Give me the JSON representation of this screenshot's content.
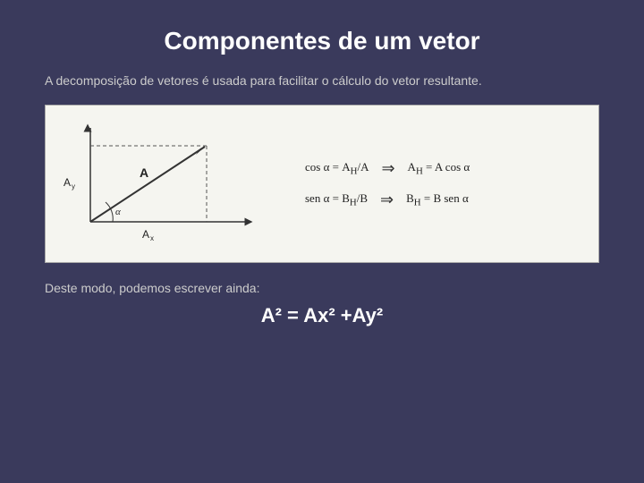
{
  "slide": {
    "title": "Componentes de um vetor",
    "description": "A decomposição de vetores é usada para facilitar o cálculo do vetor resultante.",
    "formula1_left": "cos α = A",
    "formula1_sub_left": "H",
    "formula1_mid": "/A",
    "formula1_arrow": "⇒",
    "formula1_right": "A",
    "formula1_sub_right": "H",
    "formula1_end": "= A cos α",
    "formula2_left": "sen α = B",
    "formula2_sub_left": "H",
    "formula2_mid": "/B",
    "formula2_arrow": "⇒",
    "formula2_right": "B",
    "formula2_sub_right": "H",
    "formula2_end": "= B sen α",
    "bottom_text": "Deste modo, podemos escrever ainda:",
    "math_result": "A² = Ax² +Ay²",
    "diagram": {
      "label_A": "A",
      "label_Ay": "Ay",
      "label_Ax": "Ax",
      "label_alpha": "α"
    }
  }
}
